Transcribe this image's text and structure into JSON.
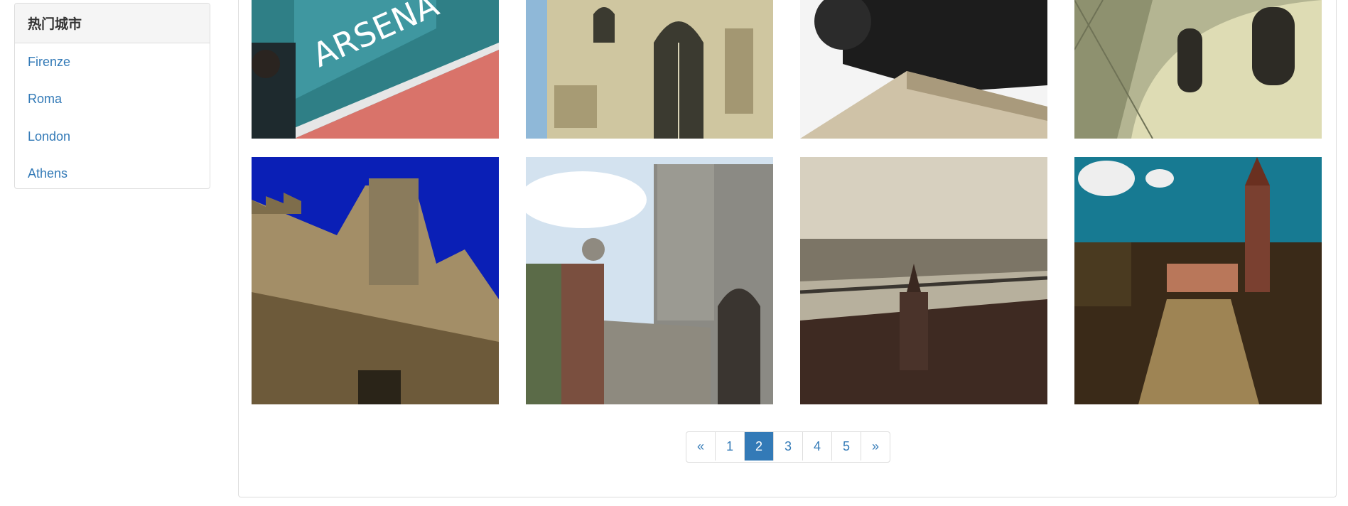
{
  "sidebar": {
    "title": "热门城市",
    "items": [
      {
        "label": "Firenze"
      },
      {
        "label": "Roma"
      },
      {
        "label": "London"
      },
      {
        "label": "Athens"
      }
    ]
  },
  "gallery": {
    "images": [
      {
        "name": "stadium-sign-photo",
        "sign_text": "ARSENA"
      },
      {
        "name": "gothic-cathedral-photo"
      },
      {
        "name": "equestrian-statue-photo"
      },
      {
        "name": "domed-museum-photo"
      },
      {
        "name": "castle-tower-photo"
      },
      {
        "name": "castle-gatehouse-photo"
      },
      {
        "name": "river-city-bridge-photo"
      },
      {
        "name": "garden-church-photo"
      }
    ]
  },
  "pagination": {
    "prev_label": "«",
    "pages": [
      "1",
      "2",
      "3",
      "4",
      "5"
    ],
    "active_page": "2",
    "next_label": "»"
  },
  "colors": {
    "link": "#337ab7",
    "active_page_bg": "#337ab7",
    "panel_border": "#dddddd",
    "panel_heading_bg": "#f5f5f5"
  }
}
